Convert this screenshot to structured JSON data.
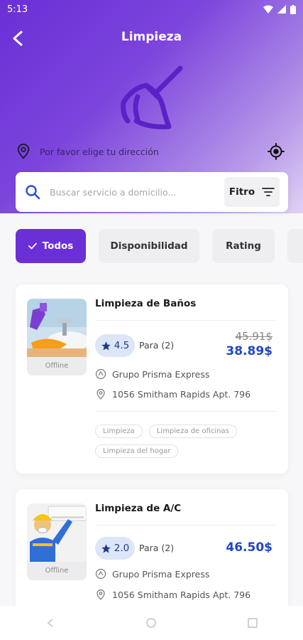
{
  "status_bar": {
    "time": "5:13"
  },
  "header": {
    "title": "Limpieza",
    "address_prompt": "Por favor elige tu dirección"
  },
  "search": {
    "placeholder": "Buscar servicio a domicilio...",
    "filter_label": "Fitro"
  },
  "chips": [
    {
      "label": "Todos",
      "active": true
    },
    {
      "label": "Disponibilidad",
      "active": false
    },
    {
      "label": "Rating",
      "active": false
    }
  ],
  "services": [
    {
      "title": "Limpieza de Baños",
      "status": "Offline",
      "rating": "4.5",
      "reviews": "Para (2)",
      "old_price": "45.91$",
      "price": "38.89$",
      "provider": "Grupo Prisma Express",
      "address": "1056 Smitham Rapids Apt. 796",
      "tags": [
        "Limpieza",
        "Limpieza de oficinas",
        "Limpieza del hogar"
      ]
    },
    {
      "title": "Limpieza de A/C",
      "status": "Offline",
      "rating": "2.0",
      "reviews": "Para (2)",
      "price": "46.50$",
      "provider": "Grupo Prisma Express",
      "address": "1056 Smitham Rapids Apt. 796"
    }
  ],
  "colors": {
    "primary": "#6a2fd6",
    "price": "#1f45c9",
    "rating_bg": "#dde6f7"
  }
}
